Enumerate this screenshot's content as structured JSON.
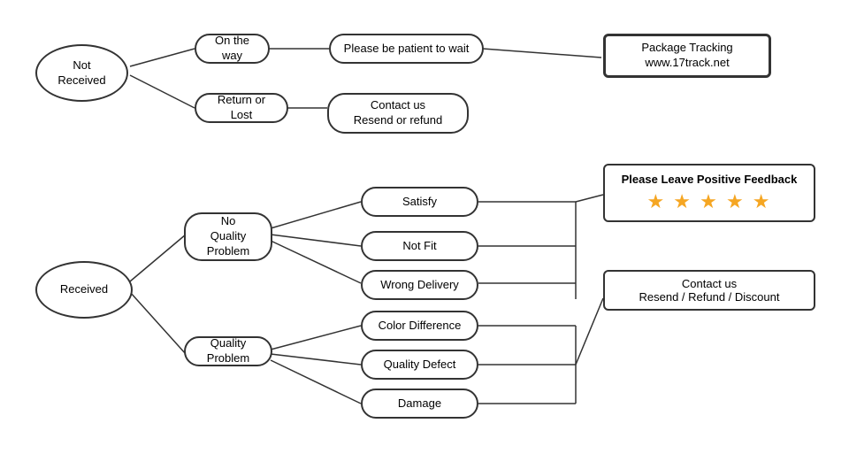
{
  "nodes": {
    "not_received": {
      "label": "Not\nReceived"
    },
    "on_the_way": {
      "label": "On the way"
    },
    "return_or_lost": {
      "label": "Return or Lost"
    },
    "patient_wait": {
      "label": "Please be patient to wait"
    },
    "contact_resend_refund": {
      "label": "Contact us\nResend or refund"
    },
    "package_tracking": {
      "label": "Package Tracking\nwww.17track.net"
    },
    "received": {
      "label": "Received"
    },
    "no_quality_problem": {
      "label": "No\nQuality Problem"
    },
    "quality_problem": {
      "label": "Quality Problem"
    },
    "satisfy": {
      "label": "Satisfy"
    },
    "not_fit": {
      "label": "Not Fit"
    },
    "wrong_delivery": {
      "label": "Wrong Delivery"
    },
    "color_difference": {
      "label": "Color Difference"
    },
    "quality_defect": {
      "label": "Quality Defect"
    },
    "damage": {
      "label": "Damage"
    },
    "please_leave_feedback": {
      "label": "Please Leave Positive Feedback"
    },
    "stars": {
      "label": "★ ★ ★ ★ ★"
    },
    "contact_resend_refund_discount": {
      "label": "Contact us\nResend / Refund / Discount"
    }
  }
}
